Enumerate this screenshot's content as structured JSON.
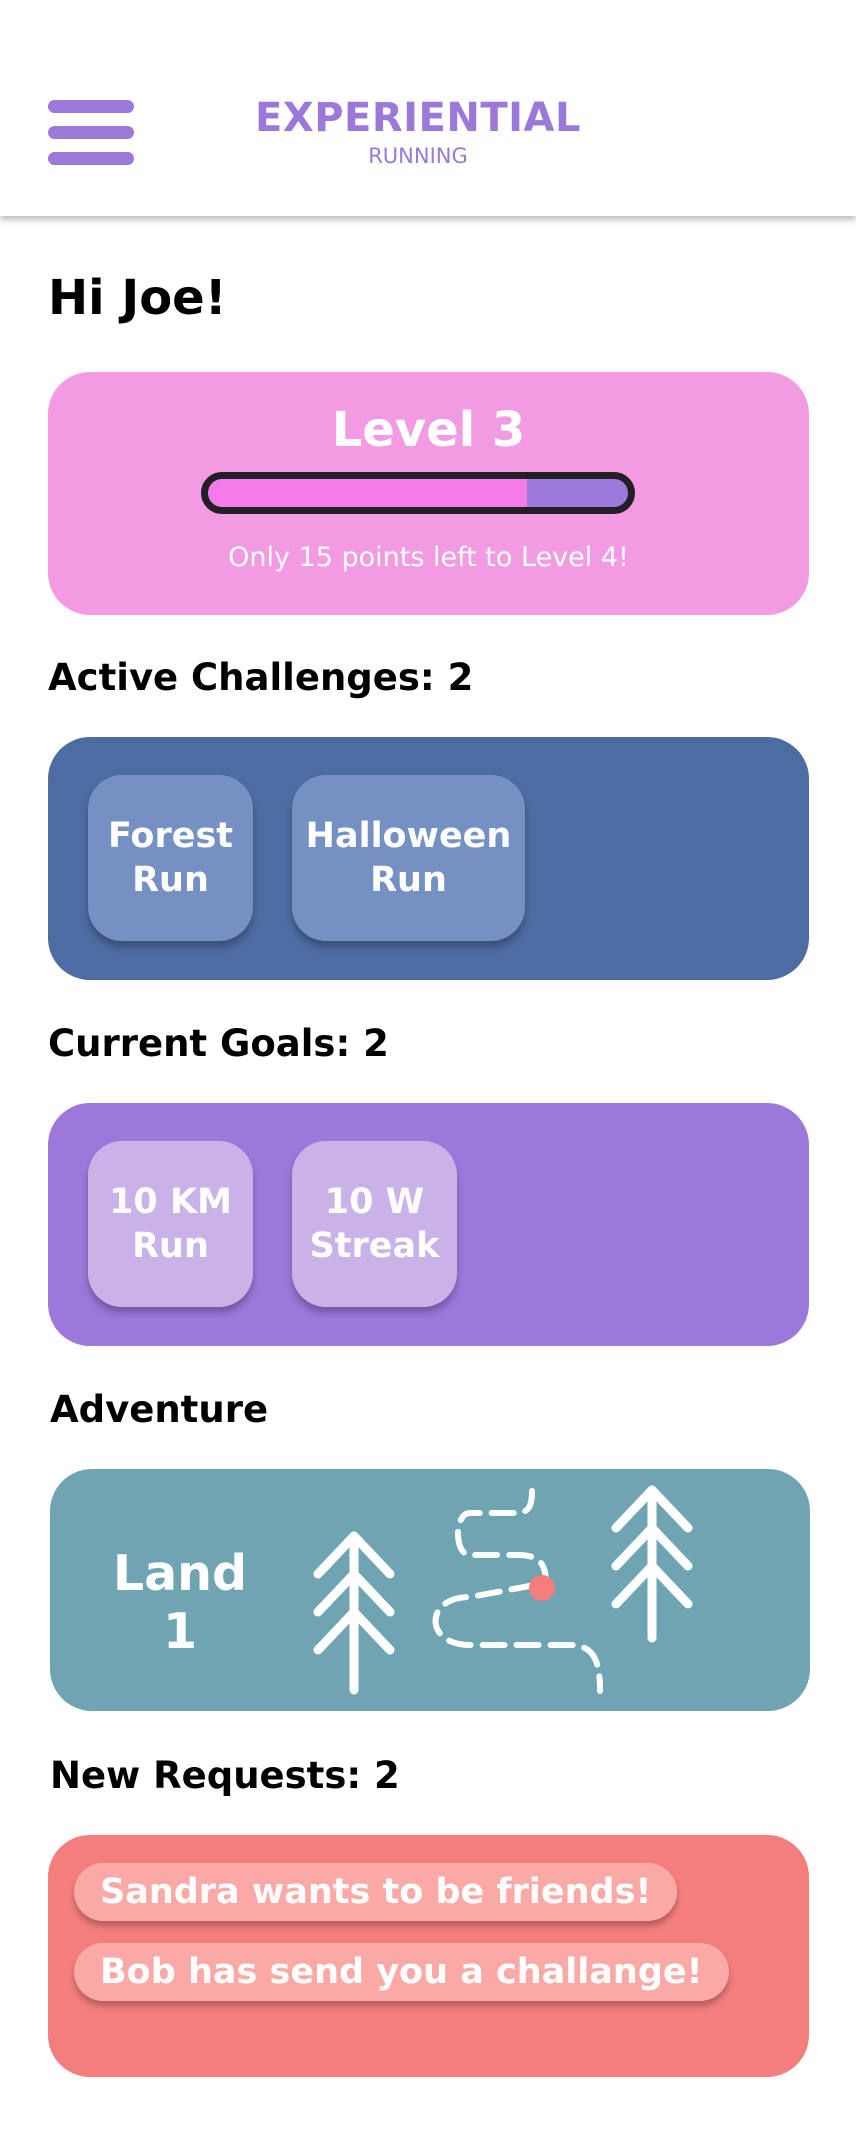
{
  "header": {
    "title": "EXPERIENTIAL",
    "subtitle": "RUNNING",
    "menu_icon": "hamburger-menu-icon"
  },
  "greeting": "Hi Joe!",
  "level": {
    "title": "Level 3",
    "progress": 0.76,
    "note": "Only 15 points left to Level 4!"
  },
  "challenges": {
    "title": "Active Challenges: 2",
    "items": [
      {
        "line1": "Forest",
        "line2": "Run"
      },
      {
        "line1": "Halloween",
        "line2": "Run"
      }
    ]
  },
  "goals": {
    "title": "Current Goals: 2",
    "items": [
      {
        "line1": "10 KM",
        "line2": "Run"
      },
      {
        "line1": "10 W",
        "line2": "Streak"
      }
    ]
  },
  "adventure": {
    "title": "Adventure",
    "land_line1": "Land",
    "land_line2": "1",
    "icons": [
      "tree-icon",
      "trail-path-icon",
      "location-dot-icon"
    ]
  },
  "requests": {
    "title": "New Requests: 2",
    "items": [
      "Sandra wants to be friends!",
      "Bob has send you a challange!"
    ]
  },
  "colors": {
    "brand_purple": "#9b78da",
    "level_pink": "#f29be3",
    "progress_fill": "#f47be8",
    "challenge_blue": "#4d6ca1",
    "challenge_tile": "#7591c4",
    "goal_tile": "#c9b2e7",
    "adventure_teal": "#6fa5b2",
    "trail_dot": "#f47d7d",
    "request_coral": "#f47d7d",
    "request_pill": "#fba9a6"
  }
}
